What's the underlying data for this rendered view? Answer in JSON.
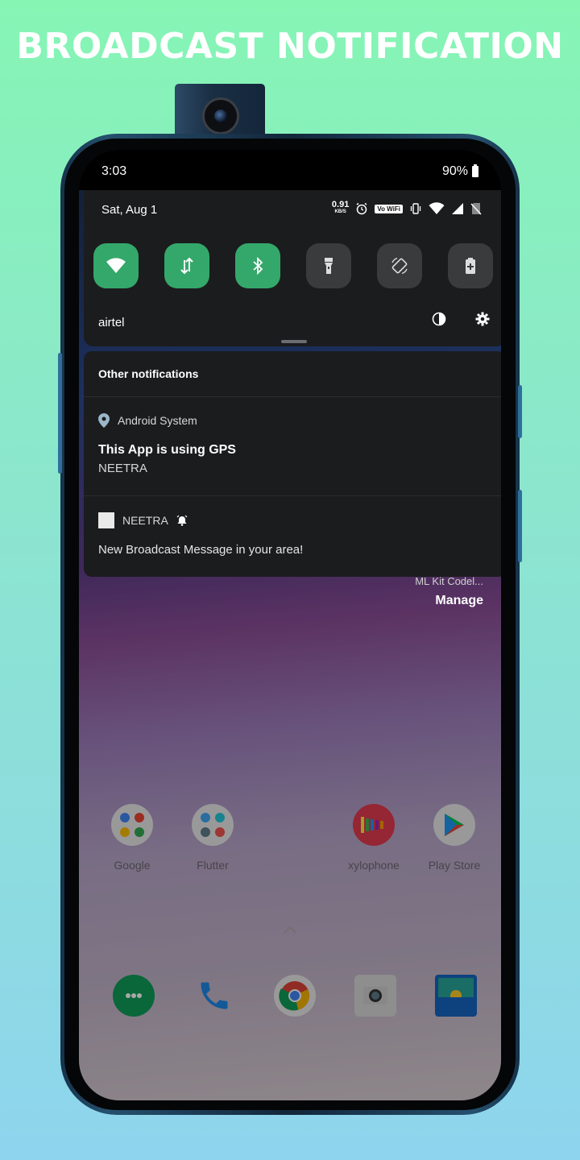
{
  "headline": "BROADCAST NOTIFICATION",
  "status_bar": {
    "time": "3:03",
    "battery": "90%"
  },
  "quick_settings": {
    "date": "Sat, Aug 1",
    "net_speed_value": "0.91",
    "net_speed_unit": "KB/S",
    "volte_badge": "Vo WiFi",
    "carrier": "airtel",
    "tiles": [
      {
        "name": "wifi",
        "state": "on"
      },
      {
        "name": "mobile-data",
        "state": "on"
      },
      {
        "name": "bluetooth",
        "state": "on"
      },
      {
        "name": "flashlight",
        "state": "off"
      },
      {
        "name": "auto-rotate",
        "state": "off"
      },
      {
        "name": "battery-saver",
        "state": "off"
      }
    ]
  },
  "notifications": {
    "section_title": "Other notifications",
    "items": [
      {
        "app": "Android System",
        "title": "This App is using GPS",
        "text": "NEETRA",
        "icon": "location-icon"
      },
      {
        "app": "NEETRA",
        "text": "New Broadcast Message in your area!",
        "icon": "alarm-icon"
      }
    ],
    "footer_channel": "ML Kit Codel...",
    "manage_label": "Manage"
  },
  "home_screen": {
    "apps": [
      {
        "label": "Google"
      },
      {
        "label": "Flutter"
      },
      {
        "label": "xylophone"
      },
      {
        "label": "Play Store"
      }
    ],
    "dock": [
      "Hangouts",
      "Phone",
      "Chrome",
      "Camera",
      "Gallery"
    ]
  },
  "colors": {
    "tile_on": "#34a86a",
    "tile_off": "#3a3b3d",
    "panel": "#1b1c1e"
  }
}
